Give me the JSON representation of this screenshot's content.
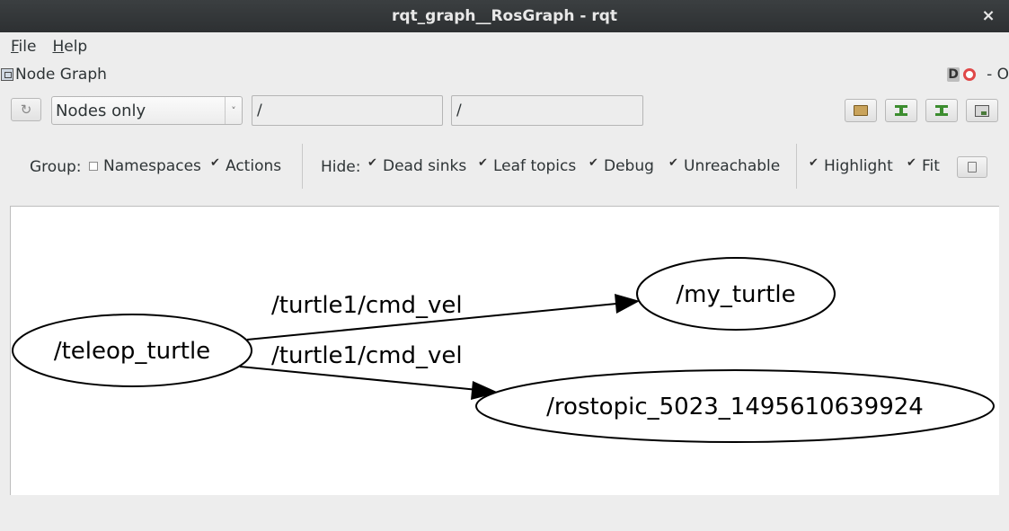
{
  "window": {
    "title": "rqt_graph__RosGraph - rqt",
    "close_glyph": "×"
  },
  "menu": [
    {
      "accel": "F",
      "rest": "ile"
    },
    {
      "accel": "H",
      "rest": "elp"
    }
  ],
  "plugin": {
    "title": "Node Graph",
    "d_label": "D",
    "dash_label": "- O"
  },
  "toolbar": {
    "mode": "Nodes only",
    "node_filter": "/",
    "topic_filter": "/",
    "icons": [
      "refresh-icon",
      "folder-icon",
      "fit-in-view-icon",
      "fit-in-view-icon",
      "save-image-icon"
    ]
  },
  "options": {
    "group_label": "Group:",
    "hide_label": "Hide:",
    "namespaces": {
      "label": "Namespaces",
      "checked": false
    },
    "actions": {
      "label": "Actions",
      "checked": true
    },
    "dead_sinks": {
      "label": "Dead sinks",
      "checked": true
    },
    "leaf_topics": {
      "label": "Leaf topics",
      "checked": true
    },
    "debug": {
      "label": "Debug",
      "checked": true
    },
    "unreachable": {
      "label": "Unreachable",
      "checked": true
    },
    "highlight": {
      "label": "Highlight",
      "checked": true
    },
    "fit": {
      "label": "Fit",
      "checked": true
    }
  },
  "graph": {
    "nodes": {
      "teleop": "/teleop_turtle",
      "my_turtle": "/my_turtle",
      "rostopic": "/rostopic_5023_1495610639924"
    },
    "edges": {
      "to_my_turtle": "/turtle1/cmd_vel",
      "to_rostopic": "/turtle1/cmd_vel"
    }
  }
}
